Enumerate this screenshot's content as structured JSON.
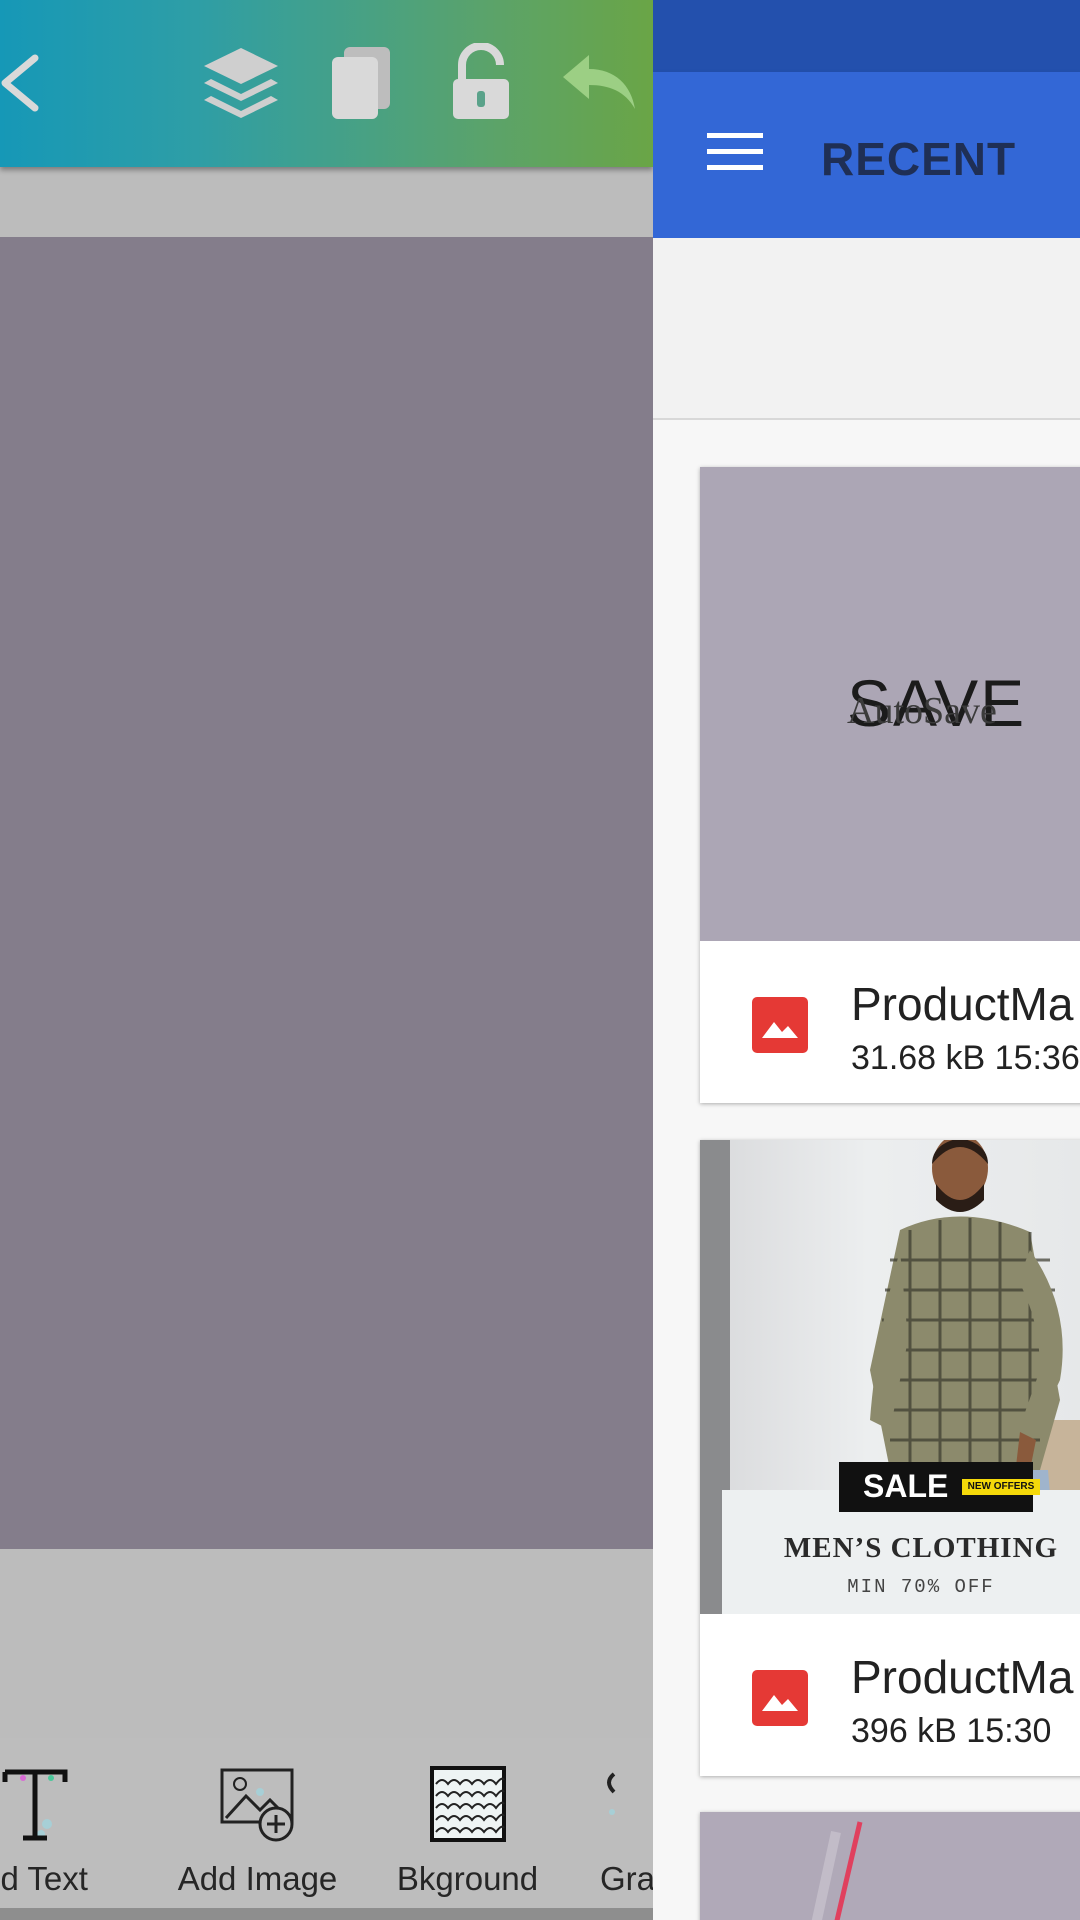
{
  "editor": {
    "toolbar_icons": [
      "back-chevron-icon",
      "layers-icon",
      "duplicate-icon",
      "unlock-icon",
      "undo-icon"
    ],
    "bottom_tools": [
      {
        "label": "dd Text",
        "icon": "add-text-icon"
      },
      {
        "label": "Add Image",
        "icon": "add-image-icon"
      },
      {
        "label": "Bkground",
        "icon": "background-pattern-icon"
      },
      {
        "label": "Gra",
        "icon": "graphics-icon"
      }
    ]
  },
  "panel": {
    "title": "RECENT",
    "menu_icon": "hamburger-menu-icon",
    "items": [
      {
        "name": "ProductMa",
        "meta": "31.68 kB 15:36",
        "thumb": {
          "big_text": "SAVE",
          "small_text": "AutoSave"
        }
      },
      {
        "name": "ProductMa",
        "meta": "396 kB 15:30",
        "thumb": {
          "sale": "SALE",
          "offers": "NEW OFFERS",
          "title": "MEN’S CLOTHING",
          "subtitle": "MIN 70% OFF"
        }
      }
    ]
  },
  "colors": {
    "toolbar_start": "#1698b7",
    "toolbar_end": "#6aa546",
    "appbar": "#3367d6",
    "statusbar": "#2350ad",
    "canvas": "#847d8b",
    "file_icon": "#e53935"
  }
}
